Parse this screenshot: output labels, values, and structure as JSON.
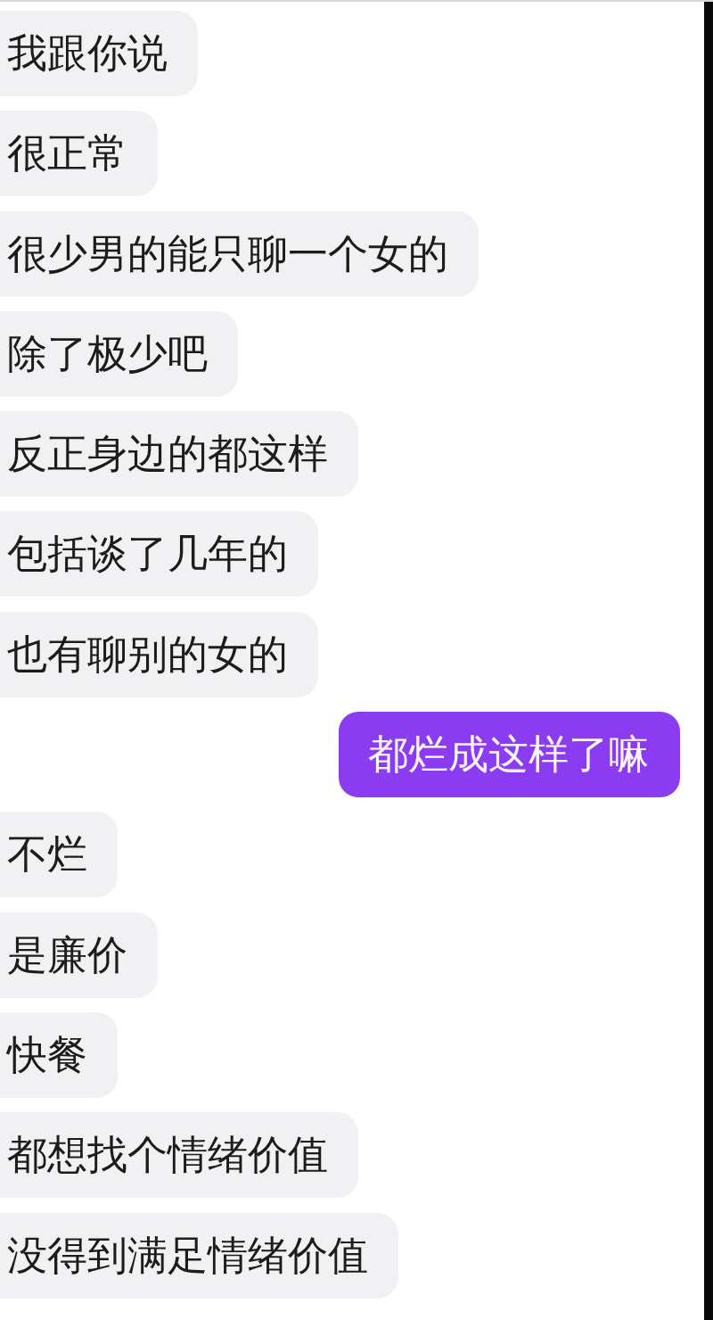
{
  "messages": [
    {
      "kind": "received",
      "text": "我跟你说"
    },
    {
      "kind": "received",
      "text": "很正常"
    },
    {
      "kind": "received",
      "text": "很少男的能只聊一个女的"
    },
    {
      "kind": "received",
      "text": "除了极少吧"
    },
    {
      "kind": "received",
      "text": "反正身边的都这样"
    },
    {
      "kind": "received",
      "text": "包括谈了几年的"
    },
    {
      "kind": "received",
      "text": "也有聊别的女的"
    },
    {
      "kind": "sent",
      "text": "都烂成这样了嘛"
    },
    {
      "kind": "received",
      "text": "不烂"
    },
    {
      "kind": "received",
      "text": "是廉价"
    },
    {
      "kind": "received",
      "text": "快餐"
    },
    {
      "kind": "received",
      "text": "都想找个情绪价值"
    },
    {
      "kind": "received",
      "text": "没得到满足情绪价值"
    }
  ]
}
